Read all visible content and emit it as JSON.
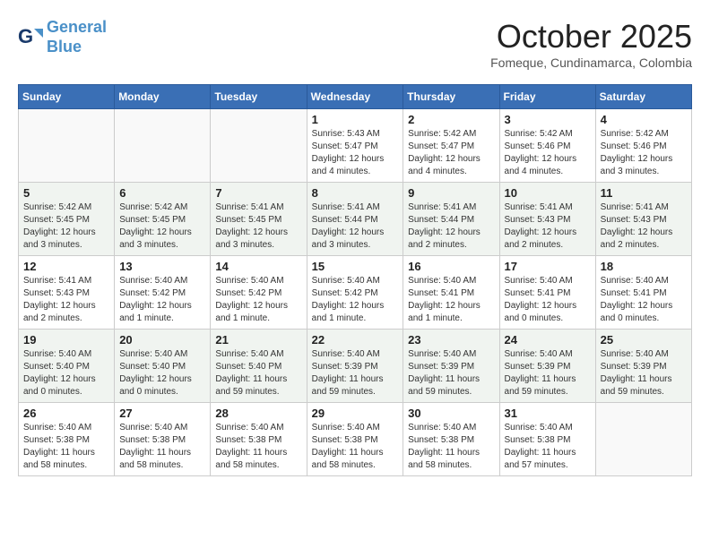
{
  "header": {
    "logo_line1": "General",
    "logo_line2": "Blue",
    "month": "October 2025",
    "location": "Fomeque, Cundinamarca, Colombia"
  },
  "days_of_week": [
    "Sunday",
    "Monday",
    "Tuesday",
    "Wednesday",
    "Thursday",
    "Friday",
    "Saturday"
  ],
  "weeks": [
    [
      {
        "day": "",
        "info": ""
      },
      {
        "day": "",
        "info": ""
      },
      {
        "day": "",
        "info": ""
      },
      {
        "day": "1",
        "info": "Sunrise: 5:43 AM\nSunset: 5:47 PM\nDaylight: 12 hours\nand 4 minutes."
      },
      {
        "day": "2",
        "info": "Sunrise: 5:42 AM\nSunset: 5:47 PM\nDaylight: 12 hours\nand 4 minutes."
      },
      {
        "day": "3",
        "info": "Sunrise: 5:42 AM\nSunset: 5:46 PM\nDaylight: 12 hours\nand 4 minutes."
      },
      {
        "day": "4",
        "info": "Sunrise: 5:42 AM\nSunset: 5:46 PM\nDaylight: 12 hours\nand 3 minutes."
      }
    ],
    [
      {
        "day": "5",
        "info": "Sunrise: 5:42 AM\nSunset: 5:45 PM\nDaylight: 12 hours\nand 3 minutes."
      },
      {
        "day": "6",
        "info": "Sunrise: 5:42 AM\nSunset: 5:45 PM\nDaylight: 12 hours\nand 3 minutes."
      },
      {
        "day": "7",
        "info": "Sunrise: 5:41 AM\nSunset: 5:45 PM\nDaylight: 12 hours\nand 3 minutes."
      },
      {
        "day": "8",
        "info": "Sunrise: 5:41 AM\nSunset: 5:44 PM\nDaylight: 12 hours\nand 3 minutes."
      },
      {
        "day": "9",
        "info": "Sunrise: 5:41 AM\nSunset: 5:44 PM\nDaylight: 12 hours\nand 2 minutes."
      },
      {
        "day": "10",
        "info": "Sunrise: 5:41 AM\nSunset: 5:43 PM\nDaylight: 12 hours\nand 2 minutes."
      },
      {
        "day": "11",
        "info": "Sunrise: 5:41 AM\nSunset: 5:43 PM\nDaylight: 12 hours\nand 2 minutes."
      }
    ],
    [
      {
        "day": "12",
        "info": "Sunrise: 5:41 AM\nSunset: 5:43 PM\nDaylight: 12 hours\nand 2 minutes."
      },
      {
        "day": "13",
        "info": "Sunrise: 5:40 AM\nSunset: 5:42 PM\nDaylight: 12 hours\nand 1 minute."
      },
      {
        "day": "14",
        "info": "Sunrise: 5:40 AM\nSunset: 5:42 PM\nDaylight: 12 hours\nand 1 minute."
      },
      {
        "day": "15",
        "info": "Sunrise: 5:40 AM\nSunset: 5:42 PM\nDaylight: 12 hours\nand 1 minute."
      },
      {
        "day": "16",
        "info": "Sunrise: 5:40 AM\nSunset: 5:41 PM\nDaylight: 12 hours\nand 1 minute."
      },
      {
        "day": "17",
        "info": "Sunrise: 5:40 AM\nSunset: 5:41 PM\nDaylight: 12 hours\nand 0 minutes."
      },
      {
        "day": "18",
        "info": "Sunrise: 5:40 AM\nSunset: 5:41 PM\nDaylight: 12 hours\nand 0 minutes."
      }
    ],
    [
      {
        "day": "19",
        "info": "Sunrise: 5:40 AM\nSunset: 5:40 PM\nDaylight: 12 hours\nand 0 minutes."
      },
      {
        "day": "20",
        "info": "Sunrise: 5:40 AM\nSunset: 5:40 PM\nDaylight: 12 hours\nand 0 minutes."
      },
      {
        "day": "21",
        "info": "Sunrise: 5:40 AM\nSunset: 5:40 PM\nDaylight: 11 hours\nand 59 minutes."
      },
      {
        "day": "22",
        "info": "Sunrise: 5:40 AM\nSunset: 5:39 PM\nDaylight: 11 hours\nand 59 minutes."
      },
      {
        "day": "23",
        "info": "Sunrise: 5:40 AM\nSunset: 5:39 PM\nDaylight: 11 hours\nand 59 minutes."
      },
      {
        "day": "24",
        "info": "Sunrise: 5:40 AM\nSunset: 5:39 PM\nDaylight: 11 hours\nand 59 minutes."
      },
      {
        "day": "25",
        "info": "Sunrise: 5:40 AM\nSunset: 5:39 PM\nDaylight: 11 hours\nand 59 minutes."
      }
    ],
    [
      {
        "day": "26",
        "info": "Sunrise: 5:40 AM\nSunset: 5:38 PM\nDaylight: 11 hours\nand 58 minutes."
      },
      {
        "day": "27",
        "info": "Sunrise: 5:40 AM\nSunset: 5:38 PM\nDaylight: 11 hours\nand 58 minutes."
      },
      {
        "day": "28",
        "info": "Sunrise: 5:40 AM\nSunset: 5:38 PM\nDaylight: 11 hours\nand 58 minutes."
      },
      {
        "day": "29",
        "info": "Sunrise: 5:40 AM\nSunset: 5:38 PM\nDaylight: 11 hours\nand 58 minutes."
      },
      {
        "day": "30",
        "info": "Sunrise: 5:40 AM\nSunset: 5:38 PM\nDaylight: 11 hours\nand 58 minutes."
      },
      {
        "day": "31",
        "info": "Sunrise: 5:40 AM\nSunset: 5:38 PM\nDaylight: 11 hours\nand 57 minutes."
      },
      {
        "day": "",
        "info": ""
      }
    ]
  ]
}
